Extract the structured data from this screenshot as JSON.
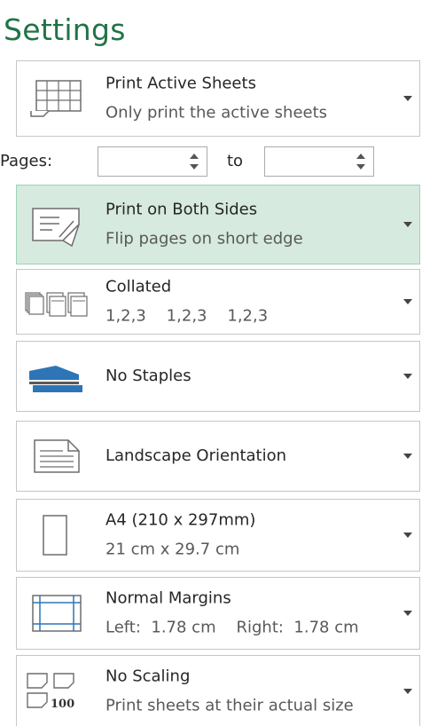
{
  "title": "Settings",
  "pages": {
    "label": "Pages:",
    "to_label": "to",
    "from_value": "",
    "to_value": ""
  },
  "settings": [
    {
      "name": "print-active-sheets",
      "icon": "sheet-grid-icon",
      "line1": "Print Active Sheets",
      "line2": "Only print the active sheets",
      "selected": false
    },
    {
      "name": "print-both-sides",
      "icon": "duplex-print-icon",
      "line1": "Print on Both Sides",
      "line2": "Flip pages on short edge",
      "selected": true
    },
    {
      "name": "collated",
      "icon": "collated-pages-icon",
      "line1": "Collated",
      "line2": "1,2,3    1,2,3    1,2,3",
      "selected": false
    },
    {
      "name": "staples",
      "icon": "stapler-icon",
      "line1": "No Staples",
      "line2": "",
      "selected": false
    },
    {
      "name": "orientation",
      "icon": "landscape-page-icon",
      "line1": "Landscape Orientation",
      "line2": "",
      "selected": false
    },
    {
      "name": "paper-size",
      "icon": "paper-size-icon",
      "line1": "A4 (210 x 297mm)",
      "line2": "21 cm x 29.7 cm",
      "selected": false
    },
    {
      "name": "margins",
      "icon": "margins-icon",
      "line1": "Normal Margins",
      "line2": "Left:  1.78 cm    Right:  1.78 cm",
      "selected": false
    },
    {
      "name": "scaling",
      "icon": "scaling-icon",
      "line1": "No Scaling",
      "line2": "Print sheets at their actual size",
      "selected": false
    }
  ],
  "colors": {
    "accent": "#217346",
    "selected_bg": "#d7eadf",
    "border": "#c6c6c6",
    "icon_blue": "#2e75b6"
  }
}
